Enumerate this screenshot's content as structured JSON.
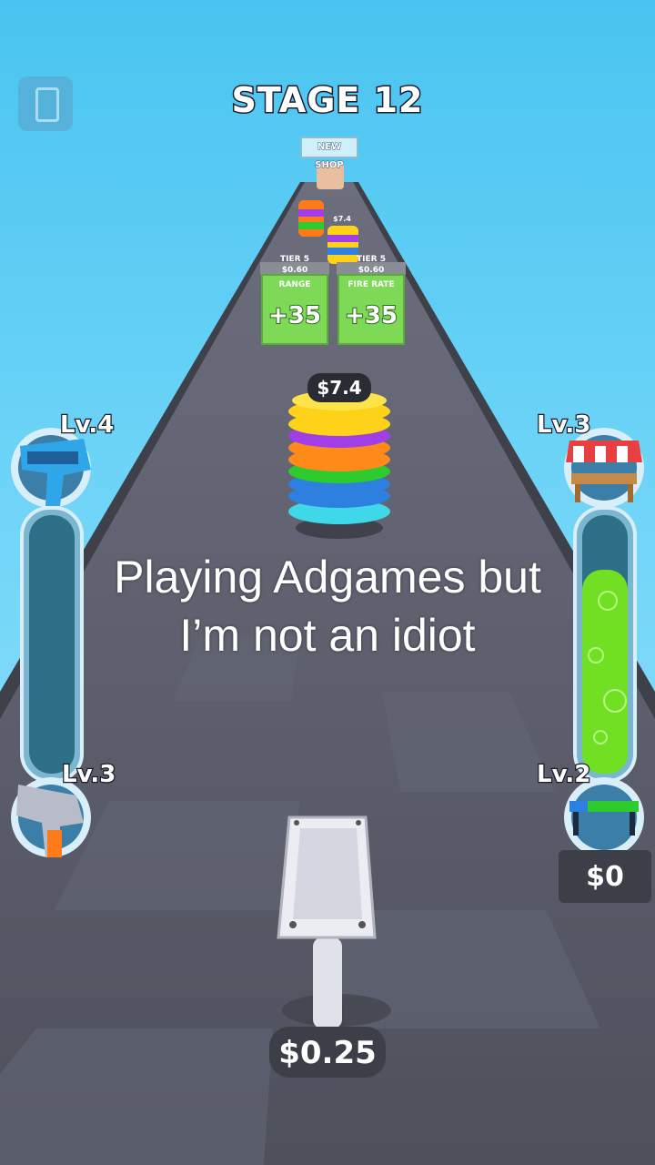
{
  "hud": {
    "stage_label": "STAGE 12",
    "phone_icon": "phone-icon"
  },
  "gates": [
    {
      "tier": "TIER 5",
      "cost": "$0.60",
      "name": "RANGE",
      "value": "+35"
    },
    {
      "tier": "TIER 5",
      "cost": "$0.60",
      "name": "FIRE RATE",
      "value": "+35"
    }
  ],
  "distant": {
    "shop_label": "NEW SHOP",
    "stack_price": "$7.4"
  },
  "stack": {
    "price": "$7.4",
    "ring_colors": [
      "#3fd8e8",
      "#2d7fe0",
      "#2ecb2e",
      "#ff8a1a",
      "#a23ee8",
      "#ffd21a"
    ]
  },
  "left_panel": {
    "top_level": "Lv.4",
    "bottom_level": "Lv.3",
    "fill": 0
  },
  "right_panel": {
    "top_level": "Lv.3",
    "bottom_level": "Lv.2",
    "fill": 0.77,
    "money": "$0"
  },
  "player": {
    "price": "$0.25"
  },
  "caption": {
    "line1": "Playing Adgames but",
    "line2": "I’m not an idiot"
  },
  "colors": {
    "sky": "#49c4f0",
    "road": "#5b5d6b",
    "gate_green": "#7ed957",
    "slime": "#72e022"
  }
}
